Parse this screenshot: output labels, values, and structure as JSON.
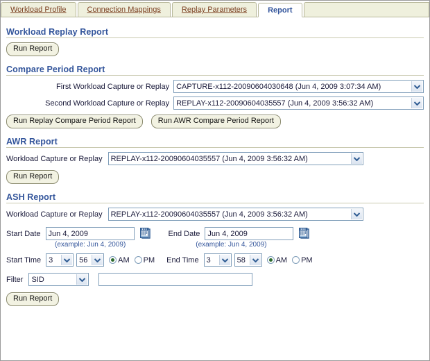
{
  "tabs": [
    {
      "label": "Workload Profile",
      "active": false
    },
    {
      "label": "Connection Mappings",
      "active": false
    },
    {
      "label": "Replay Parameters",
      "active": false
    },
    {
      "label": "Report",
      "active": true
    }
  ],
  "workload_replay_report": {
    "heading": "Workload Replay Report",
    "run_button": "Run Report"
  },
  "compare_period_report": {
    "heading": "Compare Period Report",
    "first_label": "First Workload Capture or Replay",
    "first_value": "CAPTURE-x112-20090604030648 (Jun 4, 2009 3:07:34 AM)",
    "second_label": "Second Workload Capture or Replay",
    "second_value": "REPLAY-x112-20090604035557 (Jun 4, 2009 3:56:32 AM)",
    "run_replay_button": "Run Replay Compare Period Report",
    "run_awr_button": "Run AWR Compare Period Report"
  },
  "awr_report": {
    "heading": "AWR Report",
    "workload_label": "Workload Capture or Replay",
    "workload_value": "REPLAY-x112-20090604035557 (Jun 4, 2009 3:56:32 AM)",
    "run_button": "Run Report"
  },
  "ash_report": {
    "heading": "ASH Report",
    "workload_label": "Workload Capture or Replay",
    "workload_value": "REPLAY-x112-20090604035557 (Jun 4, 2009 3:56:32 AM)",
    "start_date_label": "Start Date",
    "start_date_value": "Jun 4, 2009",
    "start_date_hint": "(example: Jun 4, 2009)",
    "end_date_label": "End Date",
    "end_date_value": "Jun 4, 2009",
    "end_date_hint": "(example: Jun 4, 2009)",
    "start_time_label": "Start Time",
    "start_time_hour": "3",
    "start_time_minute": "56",
    "start_time_am_label": "AM",
    "start_time_pm_label": "PM",
    "start_time_meridiem": "AM",
    "end_time_label": "End Time",
    "end_time_hour": "3",
    "end_time_minute": "58",
    "end_time_am_label": "AM",
    "end_time_pm_label": "PM",
    "end_time_meridiem": "AM",
    "filter_label": "Filter",
    "filter_value": "SID",
    "filter_text_value": "",
    "run_button": "Run Report"
  },
  "colors": {
    "heading_blue": "#33559b",
    "tab_link": "#7b3f20",
    "tab_bg": "#eff0dd",
    "button_bg": "#f2f2e2",
    "input_border": "#7f9db9",
    "rule": "#c8c8ae",
    "radio_dot": "#2d6b2d",
    "calendar_icon": "#2f5c93"
  },
  "icons": {
    "chevron_down": "chevron-down-icon",
    "calendar": "calendar-icon"
  }
}
